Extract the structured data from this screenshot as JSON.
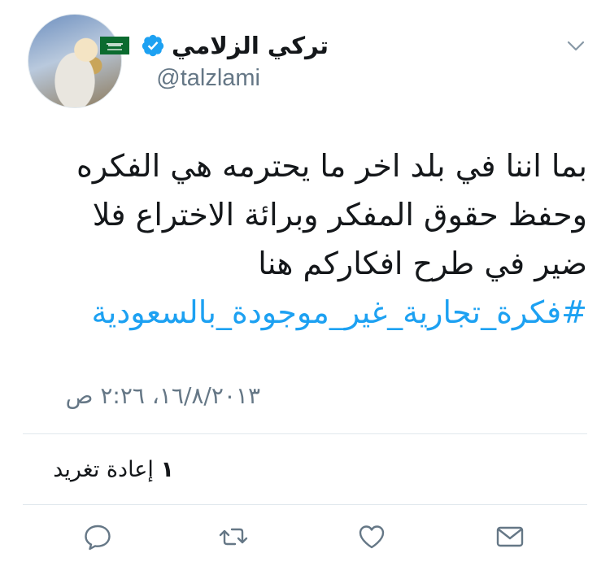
{
  "user": {
    "display_name": "تركي الزلامي",
    "handle": "@talzlami",
    "verified_icon": "verified-badge-icon",
    "flag_icon": "saudi-flag-icon"
  },
  "tweet": {
    "lines": [
      "بما اننا في بلد اخر ما يحترمه هي الفكره",
      "وحفظ حقوق المفكر وبرائة الاختراع فلا",
      "ضير في طرح افكاركم هنا"
    ],
    "hashtag": "#فكرة_تجارية_غير_موجودة_بالسعودية"
  },
  "timestamp": "١٦/٨/٢٠١٣، ٢:٢٦ ص",
  "stats": {
    "retweet_count": "١",
    "retweet_label": "إعادة تغريد"
  },
  "colors": {
    "link": "#1da1f2",
    "secondary_text": "#657786",
    "icon": "#657786",
    "verified": "#1da1f2"
  },
  "icons": [
    "reply-icon",
    "retweet-icon",
    "like-icon",
    "direct-message-icon",
    "chevron-down-icon"
  ]
}
